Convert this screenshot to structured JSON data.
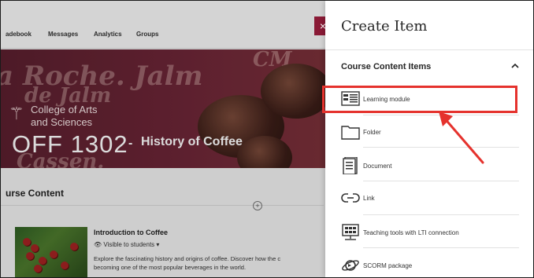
{
  "course_page": {
    "nav": [
      "adebook",
      "Messages",
      "Analytics",
      "Groups"
    ],
    "banner": {
      "script_lines": [
        "a Roche. Jalm",
        "de Jalm",
        "CM",
        "Cassen."
      ],
      "college": [
        "College of Arts",
        "and Sciences"
      ],
      "course_code": "OFF 1302",
      "dash": "-",
      "course_name": "History of Coffee"
    },
    "section_label": "urse Content",
    "item": {
      "title": "Introduction to Coffee",
      "visibility": "Visible to students",
      "description_lines": [
        "Explore the fascinating history and origins of coffee. Discover how the c",
        "becoming one of the most popular beverages in the world."
      ]
    }
  },
  "panel": {
    "close_icon": "close-icon",
    "close_label": "×",
    "title": "Create Item",
    "section": {
      "label": "Course Content Items",
      "expanded": true,
      "icon": "chevron-up-icon"
    },
    "items": [
      {
        "label": "Learning module",
        "icon": "learning-module-icon",
        "highlighted": true
      },
      {
        "label": "Folder",
        "icon": "folder-icon"
      },
      {
        "label": "Document",
        "icon": "document-icon"
      },
      {
        "label": "Link",
        "icon": "link-icon"
      },
      {
        "label": "Teaching tools with LTI connection",
        "icon": "lti-tool-icon"
      },
      {
        "label": "SCORM package",
        "icon": "scorm-package-icon"
      }
    ]
  },
  "colors": {
    "close_button": "#8a1a36",
    "highlight": "#e5322d",
    "banner": "#6d2637"
  }
}
